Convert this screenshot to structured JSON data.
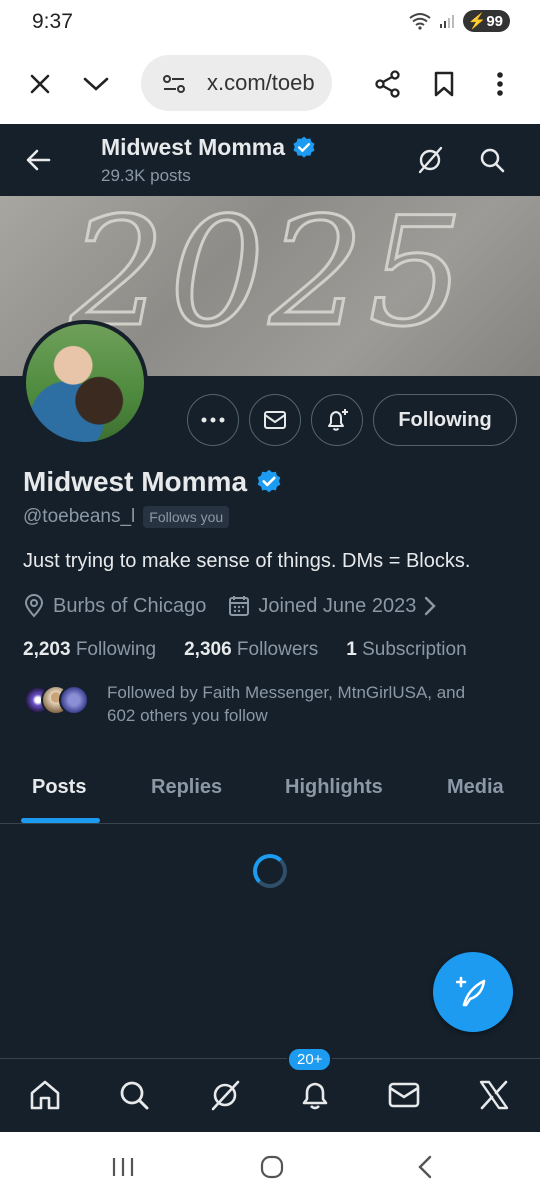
{
  "status": {
    "time": "9:37",
    "battery": "99"
  },
  "browser": {
    "url": "x.com/toeb"
  },
  "profile": {
    "top_name": "Midwest Momma",
    "post_count": "29.3K posts",
    "banner_text": "2025",
    "name": "Midwest Momma",
    "handle": "@toebeans_l",
    "follows_you": "Follows you",
    "follow_button": "Following",
    "bio": "Just trying to make sense of things. DMs = Blocks.",
    "location": "Burbs of Chicago",
    "joined": "Joined June 2023",
    "following_count": "2,203",
    "following_label": "Following",
    "followers_count": "2,306",
    "followers_label": "Followers",
    "subscription_count": "1",
    "subscription_label": "Subscription",
    "followed_by_line1": "Followed by Faith Messenger, MtnGirlUSA, and",
    "followed_by_line2": "602 others you follow"
  },
  "tabs": [
    "Posts",
    "Replies",
    "Highlights",
    "Media"
  ],
  "nav": {
    "notifications_badge": "20+"
  },
  "colors": {
    "accent": "#1d9bf0",
    "background": "#15202b",
    "verified": "#1d9bf0"
  },
  "icons": [
    "back-arrow-icon",
    "grok-icon",
    "search-icon",
    "more-icon",
    "mail-icon",
    "bell-plus-icon",
    "verified-icon",
    "location-icon",
    "calendar-icon",
    "chevron-right-icon",
    "compose-icon",
    "home-icon",
    "bell-icon",
    "x-logo-icon"
  ]
}
